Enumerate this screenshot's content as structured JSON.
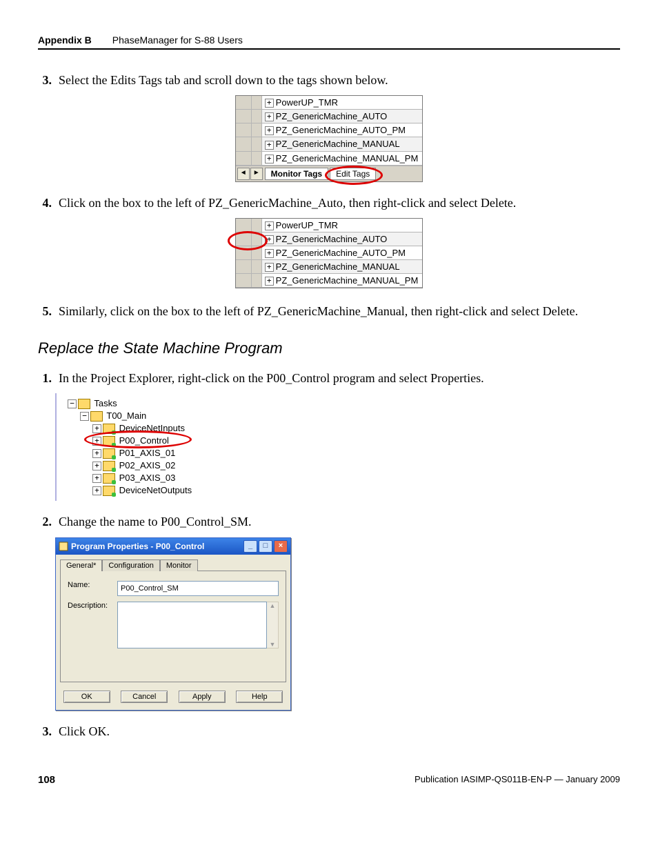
{
  "header": {
    "appendix": "Appendix B",
    "title": "PhaseManager for S-88 Users"
  },
  "step3": {
    "num": "3.",
    "text": "Select the Edits Tags tab and scroll down to the tags shown below."
  },
  "taggrid1": {
    "rows": [
      "PowerUP_TMR",
      "PZ_GenericMachine_AUTO",
      "PZ_GenericMachine_AUTO_PM",
      "PZ_GenericMachine_MANUAL",
      "PZ_GenericMachine_MANUAL_PM"
    ],
    "tabs": {
      "monitor": "Monitor Tags",
      "edit": "Edit Tags"
    }
  },
  "step4": {
    "num": "4.",
    "text": "Click on the box to the left of PZ_GenericMachine_Auto, then right-click and select Delete."
  },
  "taggrid2": {
    "rows": [
      "PowerUP_TMR",
      "PZ_GenericMachine_AUTO",
      "PZ_GenericMachine_AUTO_PM",
      "PZ_GenericMachine_MANUAL",
      "PZ_GenericMachine_MANUAL_PM"
    ]
  },
  "step5": {
    "num": "5.",
    "text": "Similarly, click on the box to the left of PZ_GenericMachine_Manual, then right-click and select Delete."
  },
  "section": "Replace the State Machine Program",
  "stepR1": {
    "num": "1.",
    "text": "In the Project Explorer, right-click on the P00_Control program and select Properties."
  },
  "tree": {
    "root": "Tasks",
    "task": "T00_Main",
    "items": [
      "DeviceNetInputs",
      "P00_Control",
      "P01_AXIS_01",
      "P02_AXIS_02",
      "P03_AXIS_03",
      "DeviceNetOutputs"
    ]
  },
  "stepR2": {
    "num": "2.",
    "text": "Change the name to P00_Control_SM."
  },
  "dialog": {
    "title": "Program Properties - P00_Control",
    "tabs": {
      "general": "General*",
      "config": "Configuration",
      "monitor": "Monitor"
    },
    "nameLabel": "Name:",
    "nameValue": "P00_Control_SM",
    "descLabel": "Description:",
    "buttons": {
      "ok": "OK",
      "cancel": "Cancel",
      "apply": "Apply",
      "help": "Help"
    }
  },
  "stepR3": {
    "num": "3.",
    "text": "Click OK."
  },
  "footer": {
    "page": "108",
    "pub": "Publication IASIMP-QS011B-EN-P — January 2009"
  }
}
